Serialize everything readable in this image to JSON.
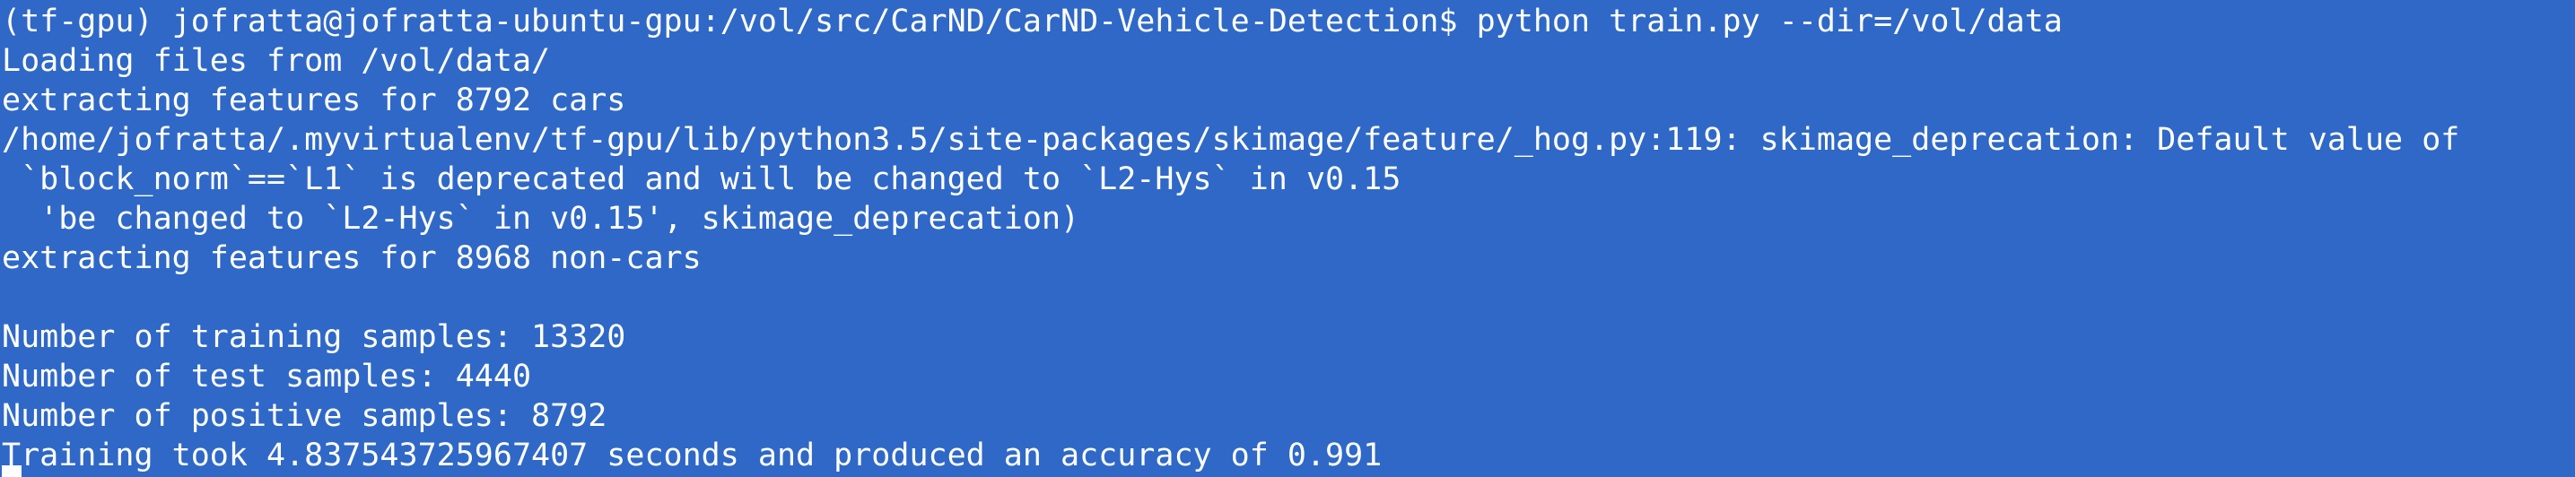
{
  "terminal": {
    "lines": [
      "(tf-gpu) jofratta@jofratta-ubuntu-gpu:/vol/src/CarND/CarND-Vehicle-Detection$ python train.py --dir=/vol/data",
      "Loading files from /vol/data/",
      "extracting features for 8792 cars",
      "/home/jofratta/.myvirtualenv/tf-gpu/lib/python3.5/site-packages/skimage/feature/_hog.py:119: skimage_deprecation: Default value of",
      " `block_norm`==`L1` is deprecated and will be changed to `L2-Hys` in v0.15",
      "  'be changed to `L2-Hys` in v0.15', skimage_deprecation)",
      "extracting features for 8968 non-cars",
      "",
      "Number of training samples: 13320",
      "Number of test samples: 4440",
      "Number of positive samples: 8792",
      "Training took 4.837543725967407 seconds and produced an accuracy of 0.991"
    ]
  }
}
